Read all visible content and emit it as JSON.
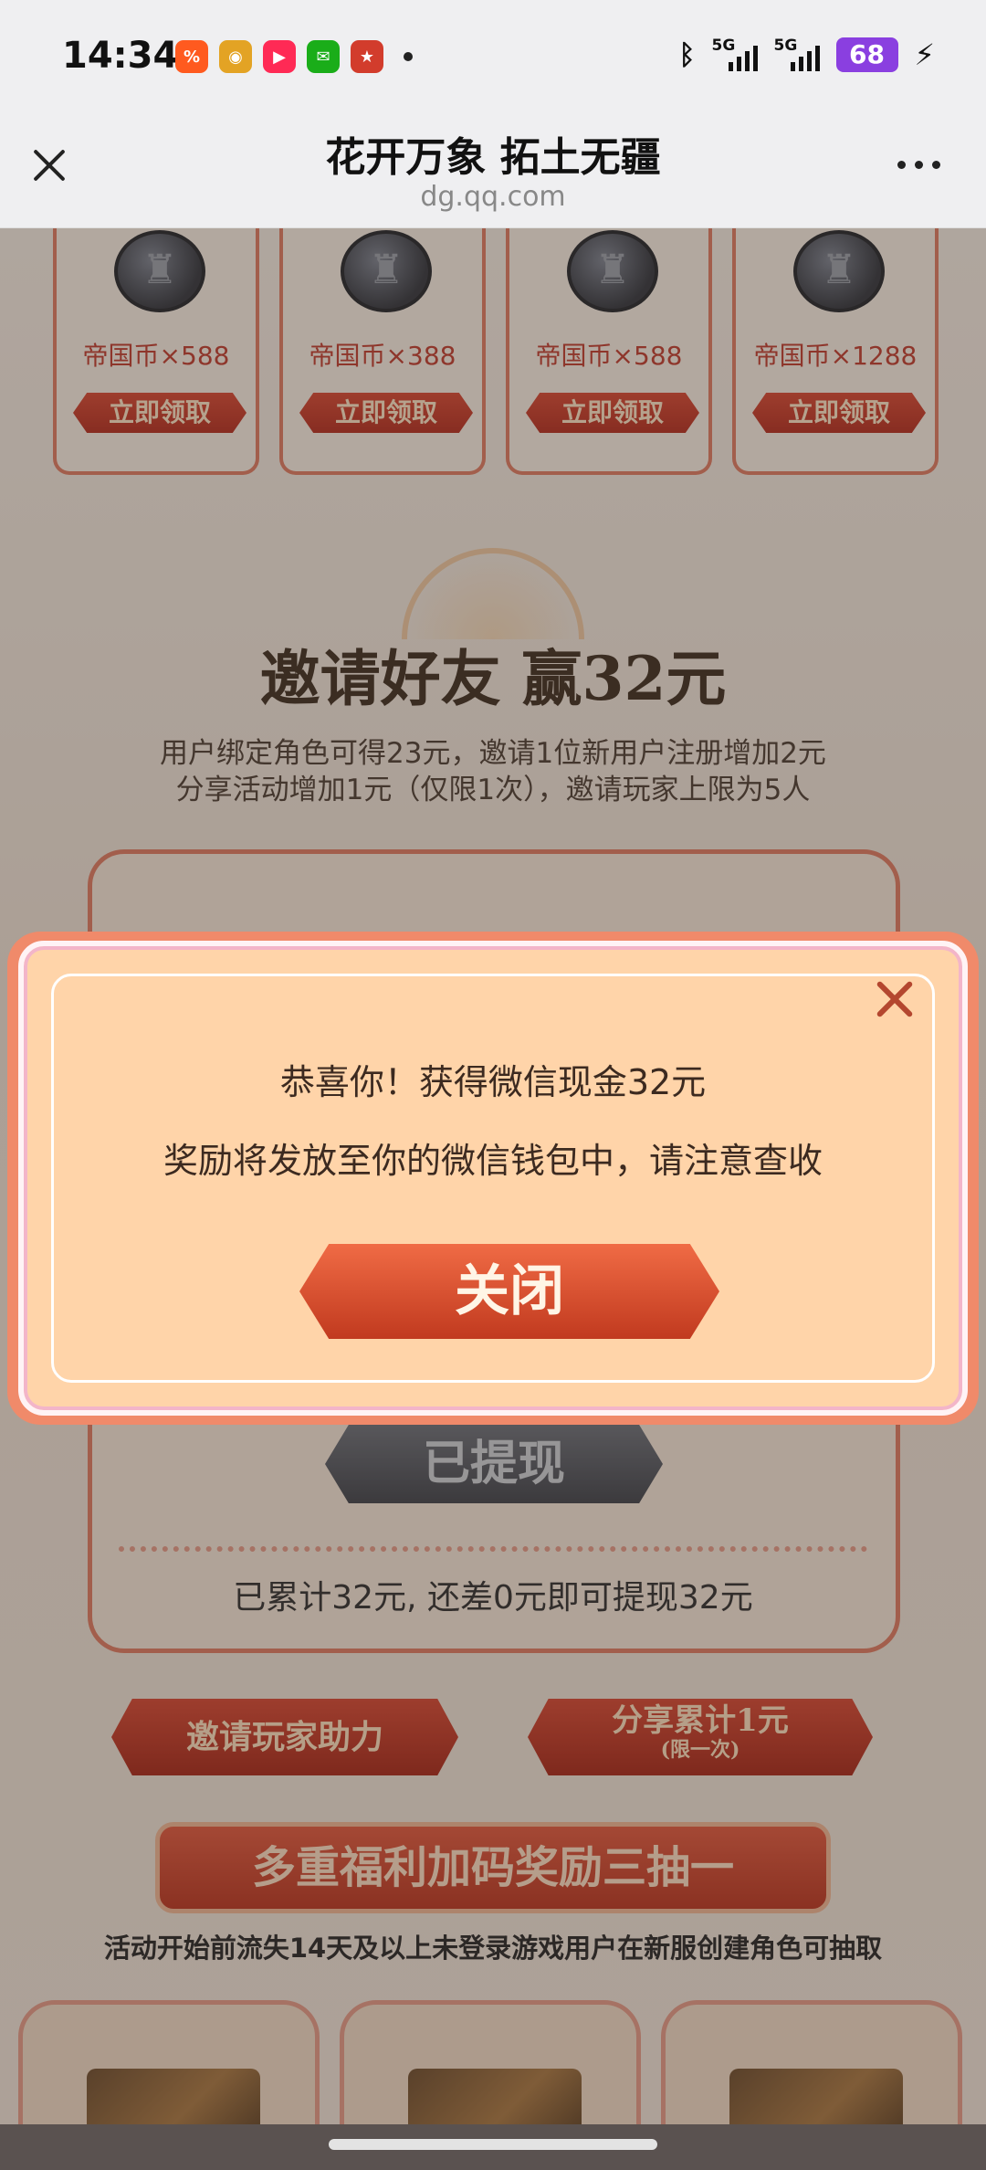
{
  "status_bar": {
    "time": "14:34",
    "apps": [
      {
        "name": "taobao-icon",
        "glyph": "%",
        "color": "#ff5a1f"
      },
      {
        "name": "weibo-icon",
        "glyph": "◉",
        "color": "#e3a324"
      },
      {
        "name": "video-icon",
        "glyph": "▶",
        "color": "#ff2a55"
      },
      {
        "name": "wechat-icon",
        "glyph": "✉",
        "color": "#1aad19"
      },
      {
        "name": "game-icon",
        "glyph": "★",
        "color": "#d23c2c"
      }
    ],
    "signal_1_label": "5G",
    "signal_2_label": "5G",
    "battery": "68"
  },
  "title_bar": {
    "title": "花开万象 拓土无疆",
    "url": "dg.qq.com"
  },
  "rewards": [
    {
      "amount": "帝国币×588",
      "button": "立即领取"
    },
    {
      "amount": "帝国币×388",
      "button": "立即领取"
    },
    {
      "amount": "帝国币×588",
      "button": "立即领取"
    },
    {
      "amount": "帝国币×1288",
      "button": "立即领取"
    }
  ],
  "invite": {
    "title": "邀请好友 赢32元",
    "desc_line1": "用户绑定角色可得23元，邀请1位新用户注册增加2元",
    "desc_line2": "分享活动增加1元（仅限1次），邀请玩家上限为5人",
    "withdrawn_label": "已提现",
    "progress_text": "已累计32元, 还差0元即可提现32元",
    "invite_button": "邀请玩家助力",
    "share_button": "分享累计1元",
    "share_button_note": "(限一次)"
  },
  "bonus": {
    "banner": "多重福利加码奖励三抽一",
    "note": "活动开始前流失14天及以上未登录游戏用户在新服创建角色可抽取"
  },
  "modal": {
    "line1": "恭喜你！获得微信现金32元",
    "line2": "奖励将发放至你的微信钱包中，请注意查收",
    "close_button": "关闭"
  }
}
